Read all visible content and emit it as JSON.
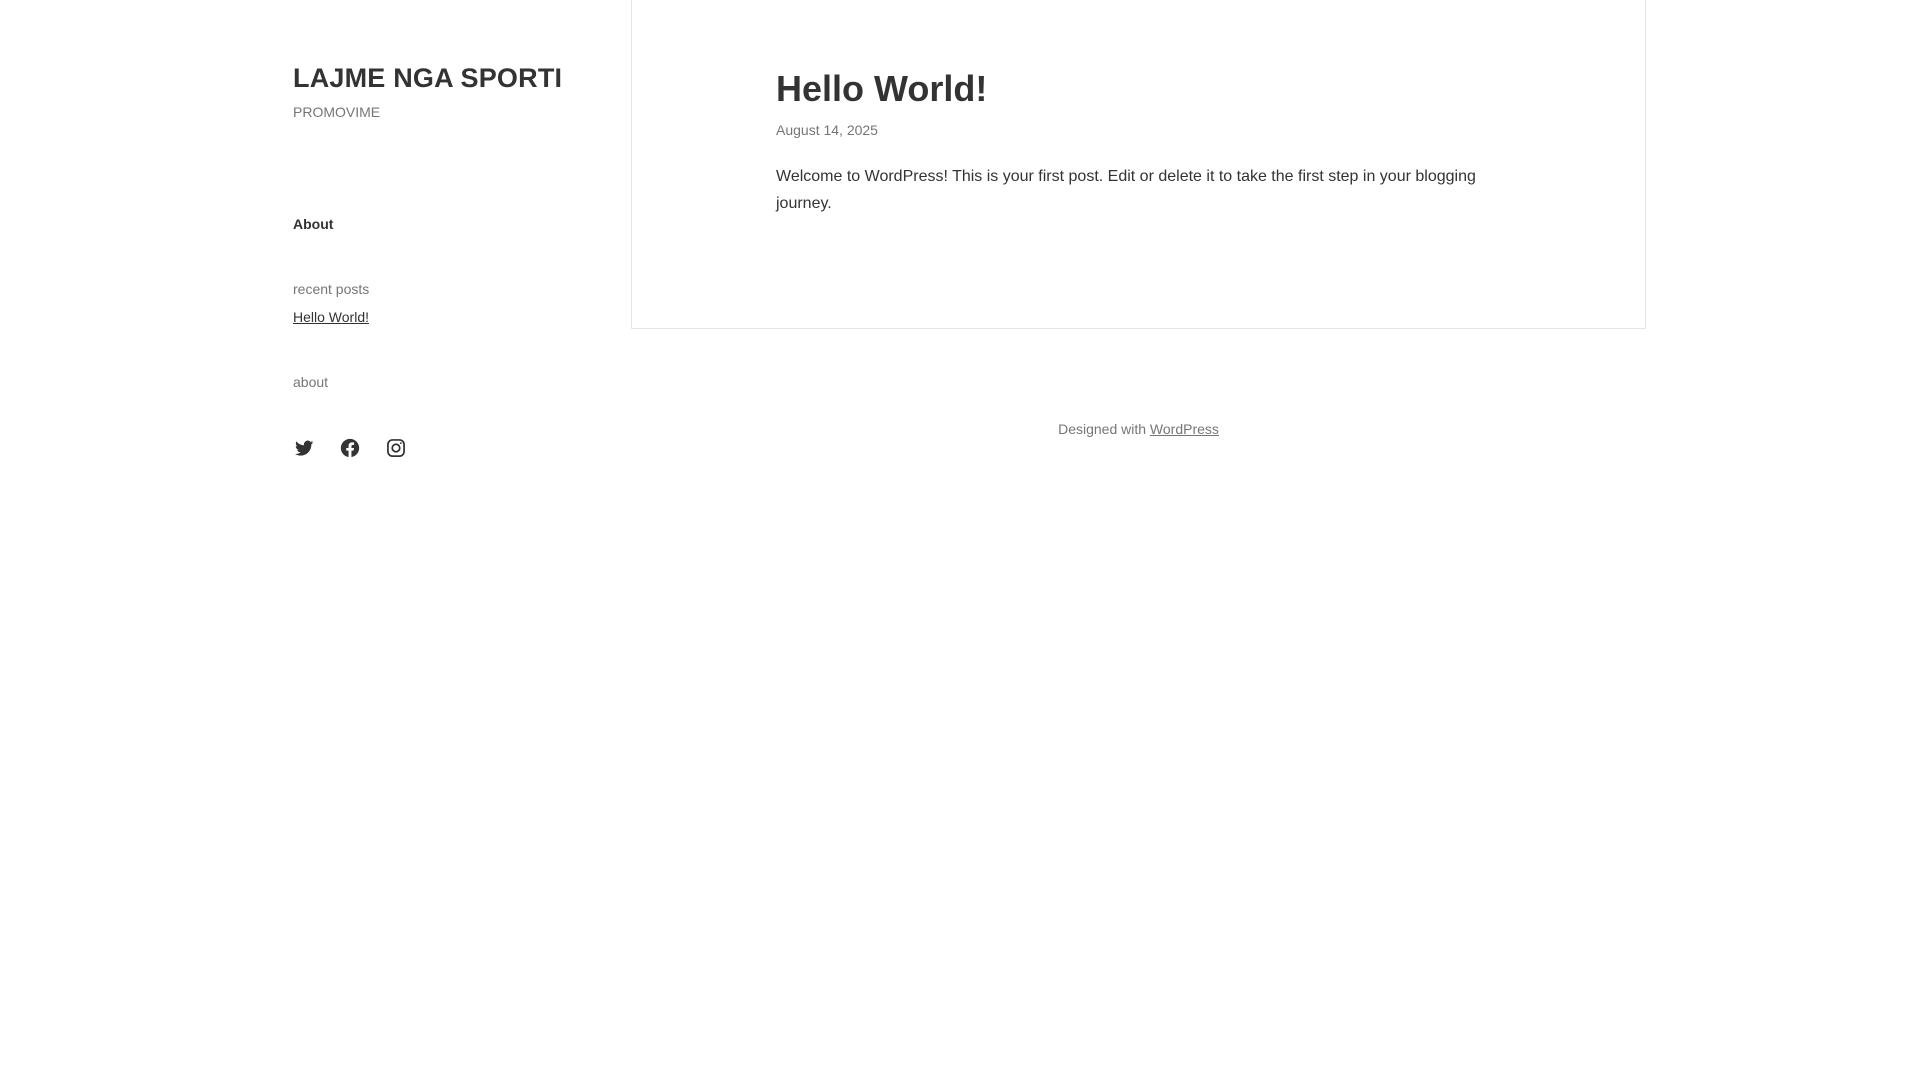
{
  "site": {
    "title": "LAJME NGA SPORTI",
    "tagline": "PROMOVIME"
  },
  "nav": {
    "about": "About"
  },
  "widgets": {
    "recent_title": "recent posts",
    "recent_posts": [
      "Hello World!"
    ],
    "about_title": "about"
  },
  "social": {
    "icons": [
      "twitter-icon",
      "facebook-icon",
      "instagram-icon"
    ]
  },
  "post": {
    "title": "Hello World!",
    "date": "August 14, 2025",
    "body": "Welcome to WordPress! This is your first post. Edit or delete it to take the first step in your blogging journey."
  },
  "footer": {
    "prefix": "Designed with",
    "link": "WordPress"
  },
  "colors": {
    "text": "#333333",
    "muted": "#767676",
    "border": "#e5e5e5",
    "background": "#ffffff"
  }
}
